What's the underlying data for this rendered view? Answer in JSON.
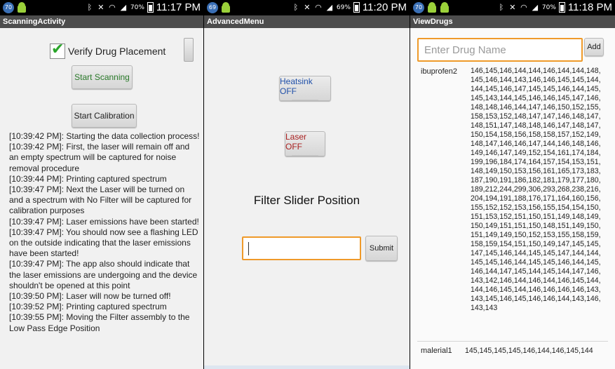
{
  "panels": [
    {
      "status": {
        "notif_count": "70",
        "battery": "70%",
        "time": "11:17 PM"
      },
      "title": "ScanningActivity",
      "verify_label": "Verify Drug Placement",
      "start_scanning": "Start Scanning",
      "start_calibration": "Start Calibration",
      "log": [
        "[10:39:42 PM]: Starting the data collection process!",
        "[10:39:42 PM]: First, the laser will remain off and an empty spectrum will be captured for noise removal procedure",
        "[10:39:44 PM]: Printing captured spectrum",
        "[10:39:47 PM]: Next the Laser will be turned on and a spectrum with No Filter will be captured for calibration purposes",
        "[10:39:47 PM]: Laser emissions have been started!",
        "[10:39:47 PM]: You should now see a flashing LED on the outside indicating that the laser emissions have been started!",
        "[10:39:47 PM]: The app also should indicate that the laser emissions are undergoing and the device shouldn't be opened at this point",
        "[10:39:50 PM]: Laser will now be turned off!",
        "[10:39:52 PM]: Printing captured spectrum",
        "[10:39:55 PM]: Moving the Filter assembly to the Low Pass Edge Position"
      ]
    },
    {
      "status": {
        "notif_count": "69",
        "battery": "69%",
        "time": "11:20 PM"
      },
      "title": "AdvancedMenu",
      "heatsink": "Heatsink OFF",
      "laser": "Laser OFF",
      "filter_label": "Filter Slider Position",
      "submit": "Submit"
    },
    {
      "status": {
        "notif_count": "70",
        "battery": "70%",
        "time": "11:18 PM"
      },
      "title": "ViewDrugs",
      "drug_placeholder": "Enter Drug Name",
      "add": "Add",
      "drugs": [
        {
          "name": "ibuprofen2",
          "values": "146,145,146,144,144,146,144,144,148,145,146,144,143,146,146,145,145,144,144,145,146,147,145,145,146,144,145,145,143,144,145,146,146,145,147,146,148,148,146,144,147,146,150,152,155,158,153,152,148,147,147,146,148,147,148,151,147,148,148,146,147,148,147,150,154,158,156,158,158,157,152,149,148,147,146,146,147,144,146,148,146,149,146,147,149,152,154,161,174,184,199,196,184,174,164,157,154,153,151,148,149,150,153,156,161,165,173,183,187,190,191,186,182,181,179,177,180,189,212,244,299,306,293,268,238,216,204,194,191,188,176,171,164,160,156,155,152,152,153,156,155,154,154,150,151,153,152,151,150,151,149,148,149,150,149,151,151,150,148,151,149,150,151,149,149,150,152,153,155,158,159,158,159,154,151,150,149,147,145,145,147,145,146,144,145,145,147,144,144,145,145,146,144,145,145,146,144,145,146,144,147,145,144,145,144,147,146,143,142,146,144,146,144,146,145,144,144,146,145,144,146,146,146,146,143,143,145,146,145,146,146,144,143,146,143,143"
        },
        {
          "name": "malerial1",
          "values": "145,145,145,145,146,144,146,145,144"
        }
      ]
    }
  ]
}
